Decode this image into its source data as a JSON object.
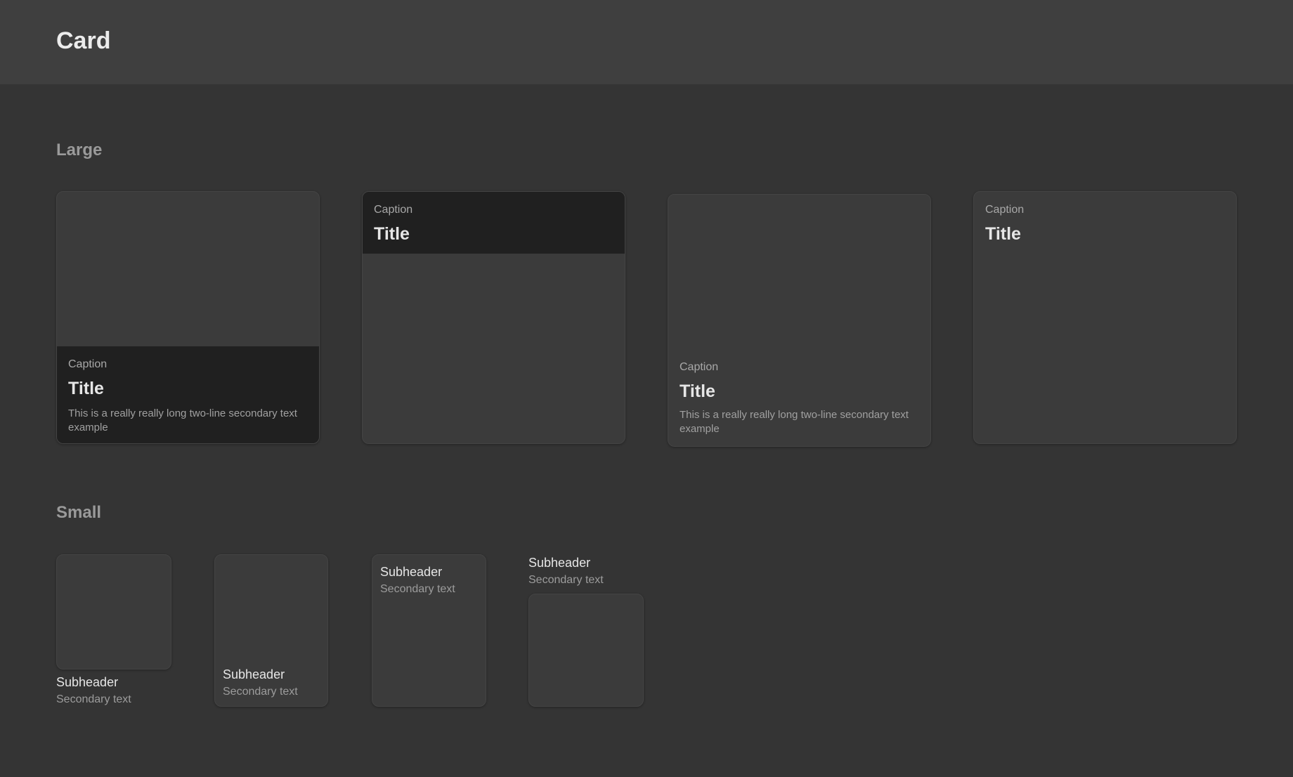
{
  "header": {
    "title": "Card"
  },
  "sections": {
    "large": {
      "title": "Large"
    },
    "small": {
      "title": "Small"
    }
  },
  "large_cards": [
    {
      "caption": "Caption",
      "title": "Title",
      "secondary": "This is a really really long two-line secondary text example"
    },
    {
      "caption": "Caption",
      "title": "Title"
    },
    {
      "caption": "Caption",
      "title": "Title",
      "secondary": "This is a really really long two-line secondary text example"
    },
    {
      "caption": "Caption",
      "title": "Title"
    }
  ],
  "small_cards": [
    {
      "subheader": "Subheader",
      "secondary": "Secondary text"
    },
    {
      "subheader": "Subheader",
      "secondary": "Secondary text"
    },
    {
      "subheader": "Subheader",
      "secondary": "Secondary text"
    },
    {
      "subheader": "Subheader",
      "secondary": "Secondary text"
    }
  ]
}
